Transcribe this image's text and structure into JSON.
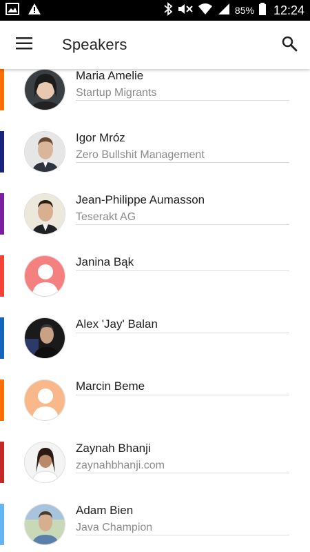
{
  "status_bar": {
    "battery_percent": "85%",
    "time": "12:24",
    "icons": [
      "gallery-icon",
      "warning-icon",
      "bluetooth-icon",
      "mute-icon",
      "wifi-icon",
      "signal-icon",
      "battery-icon"
    ]
  },
  "app_bar": {
    "title": "Speakers",
    "menu_icon": "hamburger-menu-icon",
    "search_icon": "search-icon"
  },
  "speakers": [
    {
      "name": "Maria Amelie",
      "subtitle": "Startup Migrants",
      "accent": "#ff6f00",
      "avatar": "photo"
    },
    {
      "name": "Igor Mróz",
      "subtitle": "Zero Bullshit Management",
      "accent": "#1a237e",
      "avatar": "photo"
    },
    {
      "name": "Jean-Philippe Aumasson",
      "subtitle": "Teserakt AG",
      "accent": "#7b1fa2",
      "avatar": "photo"
    },
    {
      "name": "Janina Bąk",
      "subtitle": "",
      "accent": "#f44336",
      "avatar": "placeholder",
      "avatar_color": "#f48080"
    },
    {
      "name": "Alex 'Jay' Balan",
      "subtitle": "",
      "accent": "#1565c0",
      "avatar": "photo"
    },
    {
      "name": "Marcin Beme",
      "subtitle": "",
      "accent": "#ff6f00",
      "avatar": "placeholder",
      "avatar_color": "#f9b88a"
    },
    {
      "name": "Zaynah Bhanji",
      "subtitle": "zaynahbhanji.com",
      "accent": "#c62828",
      "avatar": "photo"
    },
    {
      "name": "Adam Bien",
      "subtitle": "Java Champion",
      "accent": "#64b5f6",
      "avatar": "photo"
    }
  ]
}
